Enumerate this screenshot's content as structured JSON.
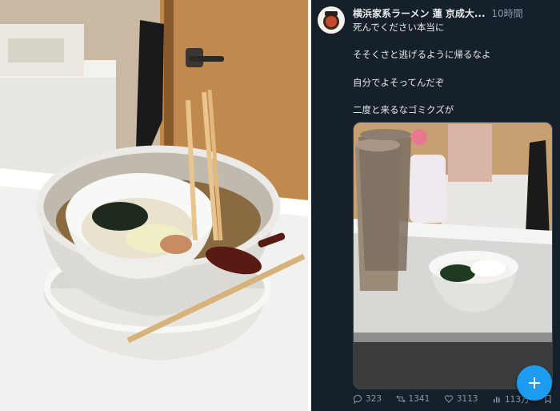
{
  "tweet": {
    "display_name": "横浜家系ラーメン 蓮 京成大...",
    "time": "10時間",
    "lines": [
      "死んでください本当に",
      "そそくさと逃げるように帰るなよ",
      "自分でよそってんだぞ",
      "二度と来るなゴミクズが"
    ]
  },
  "stats": {
    "replies": "323",
    "retweets": "1341",
    "likes": "3113",
    "views": "113万"
  },
  "icons": {
    "reply": "reply-icon",
    "retweet": "retweet-icon",
    "like": "heart-icon",
    "views": "views-icon",
    "bookmark": "bookmark-icon",
    "compose": "plus-icon"
  },
  "colors": {
    "background": "#15202b",
    "text": "#e7e9ea",
    "muted": "#8b98a5",
    "accent": "#1d9bf0"
  }
}
